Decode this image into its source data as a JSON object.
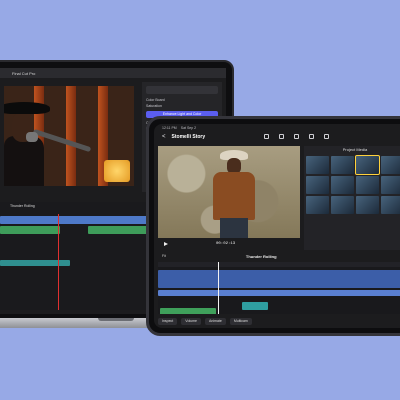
{
  "macbook": {
    "menubar_text": "Final Cut Pro",
    "inspector": {
      "header": "Color Board",
      "labels": [
        "Saturation",
        "Color Correction",
        "Mask"
      ],
      "button_label": "Enhance Light and Color"
    },
    "timeline_title": "Thunder Rolling"
  },
  "ipad": {
    "status": {
      "time": "12:11 PM",
      "date": "Sat Sep 2"
    },
    "toolbar": {
      "back_label": "<",
      "project_title": "Stomelli Story"
    },
    "viewer": {
      "timecode": "00:02:13"
    },
    "media_panel": {
      "title": "Project Media"
    },
    "timeline": {
      "badge": "Fit",
      "title": "Thunder Rolling"
    },
    "bottom_buttons": [
      "Inspect",
      "Volume",
      "Animate",
      "Multicam"
    ]
  },
  "colors": {
    "background": "#97a9e6",
    "accent": "#5b5ef0",
    "playhead": "#e03030",
    "selection": "#ffd23c"
  }
}
